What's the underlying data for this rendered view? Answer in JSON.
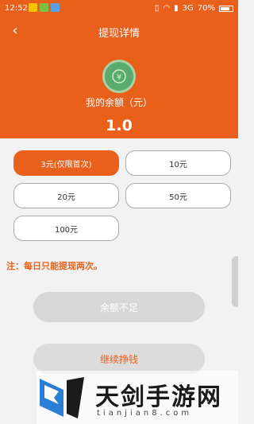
{
  "status_bar": {
    "time": "12:52",
    "signal": "3G",
    "battery": "70%"
  },
  "header": {
    "title": "提现详情",
    "balance_label": "我的余额（元）",
    "balance_value": "1.0",
    "color": "#e8601c"
  },
  "options": [
    {
      "label": "3元(仅限首次)",
      "selected": true
    },
    {
      "label": "10元",
      "selected": false
    },
    {
      "label": "20元",
      "selected": false
    },
    {
      "label": "50元",
      "selected": false
    },
    {
      "label": "100元",
      "selected": false
    }
  ],
  "note": "注：每日只能提现两次。",
  "buttons": {
    "insufficient": "余额不足",
    "continue": "继续挣钱"
  },
  "watermark": {
    "title": "天剑手游网",
    "url": "tianjian8.com"
  }
}
